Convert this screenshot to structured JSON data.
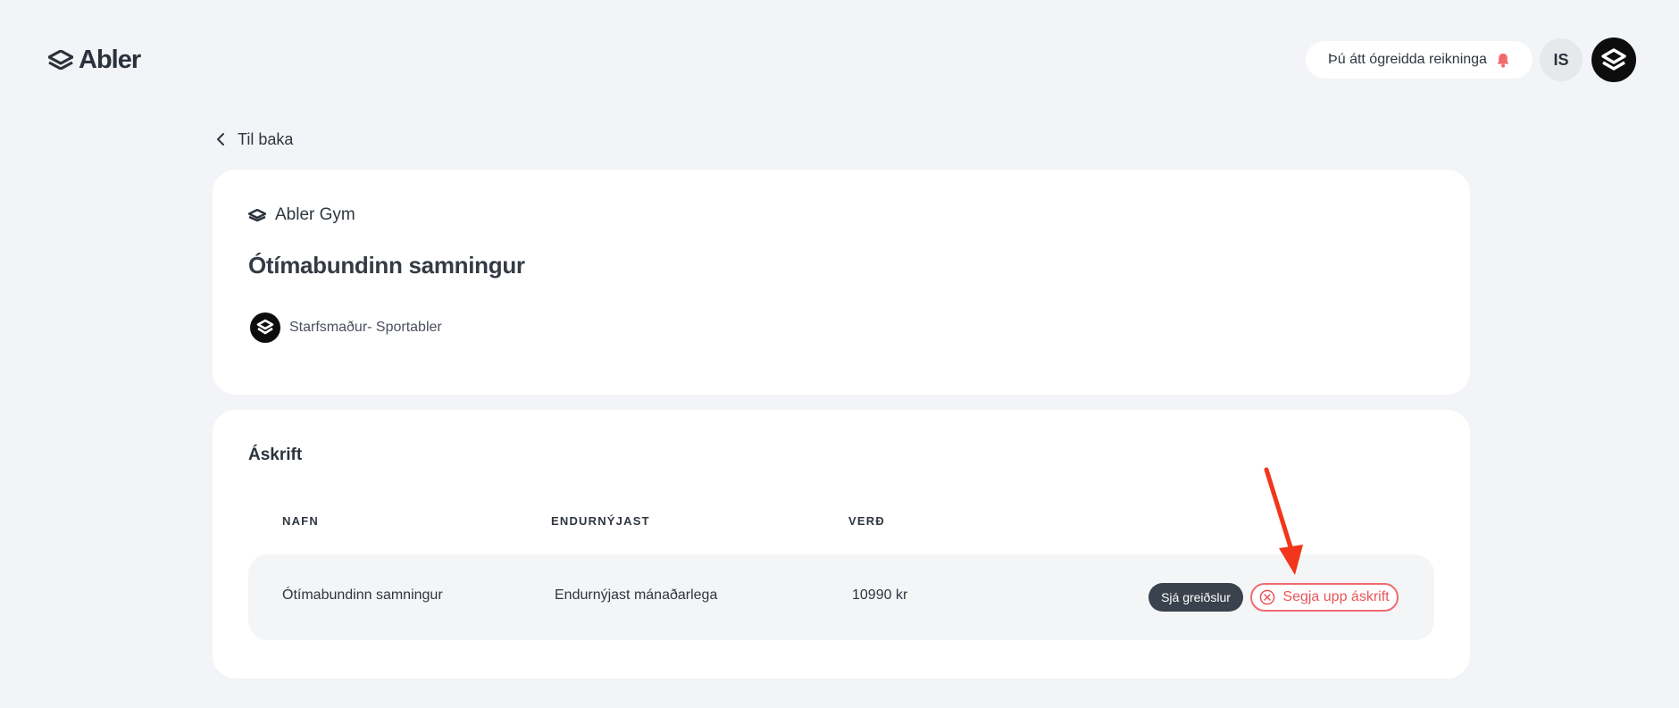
{
  "header": {
    "logo_text": "Abler",
    "notice_text": "Þú átt ógreidda reikninga",
    "language": "IS"
  },
  "nav": {
    "back_label": "Til baka"
  },
  "contract": {
    "brand": "Abler Gym",
    "title": "Ótímabundinn samningur",
    "staff": "Starfsmaður- Sportabler"
  },
  "subscription": {
    "section_title": "Áskrift",
    "columns": [
      "NAFN",
      "ENDURNÝJAST",
      "VERÐ"
    ],
    "rows": [
      {
        "name": "Ótímabundinn samningur",
        "renewal": "Endurnýjast mánaðarlega",
        "price": "10990 kr",
        "view_payments_label": "Sjá greiðslur",
        "cancel_label": "Segja upp áskrift"
      }
    ]
  },
  "colors": {
    "background": "#f2f4f7",
    "card": "#ffffff",
    "dark_button": "#3a424d",
    "cancel_accent": "#e9555a",
    "annotation_arrow": "#f2361b"
  }
}
